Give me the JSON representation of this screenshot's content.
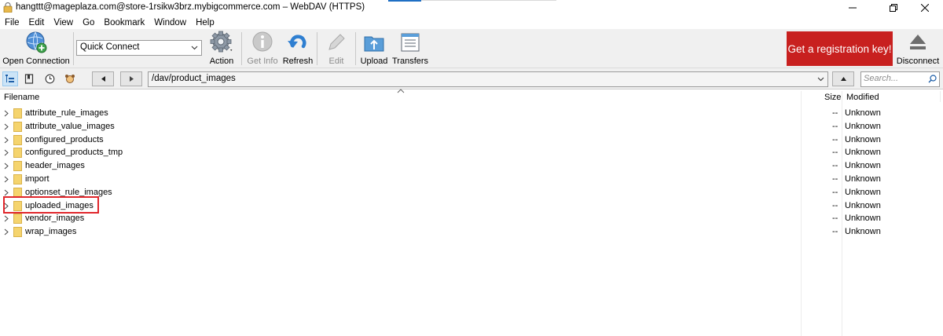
{
  "window": {
    "title": "hangttt@mageplaza.com@store-1rsikw3brz.mybigcommerce.com – WebDAV (HTTPS)"
  },
  "menu": [
    "File",
    "Edit",
    "View",
    "Go",
    "Bookmark",
    "Window",
    "Help"
  ],
  "toolbar": {
    "open_connection": "Open Connection",
    "quick_connect": "Quick Connect",
    "action": "Action",
    "get_info": "Get Info",
    "refresh": "Refresh",
    "edit": "Edit",
    "upload": "Upload",
    "transfers": "Transfers",
    "registration": "Get a registration key!",
    "disconnect": "Disconnect"
  },
  "navbar": {
    "path": "/dav/product_images",
    "search_placeholder": "Search..."
  },
  "columns": {
    "filename": "Filename",
    "size": "Size",
    "modified": "Modified"
  },
  "files": [
    {
      "name": "attribute_rule_images",
      "size": "--",
      "modified": "Unknown"
    },
    {
      "name": "attribute_value_images",
      "size": "--",
      "modified": "Unknown"
    },
    {
      "name": "configured_products",
      "size": "--",
      "modified": "Unknown"
    },
    {
      "name": "configured_products_tmp",
      "size": "--",
      "modified": "Unknown"
    },
    {
      "name": "header_images",
      "size": "--",
      "modified": "Unknown"
    },
    {
      "name": "import",
      "size": "--",
      "modified": "Unknown"
    },
    {
      "name": "optionset_rule_images",
      "size": "--",
      "modified": "Unknown"
    },
    {
      "name": "uploaded_images",
      "size": "--",
      "modified": "Unknown"
    },
    {
      "name": "vendor_images",
      "size": "--",
      "modified": "Unknown"
    },
    {
      "name": "wrap_images",
      "size": "--",
      "modified": "Unknown"
    }
  ],
  "colors": {
    "registration_bg": "#c8201f",
    "highlight_border": "#e0262b",
    "folder": "#f5d46e"
  }
}
